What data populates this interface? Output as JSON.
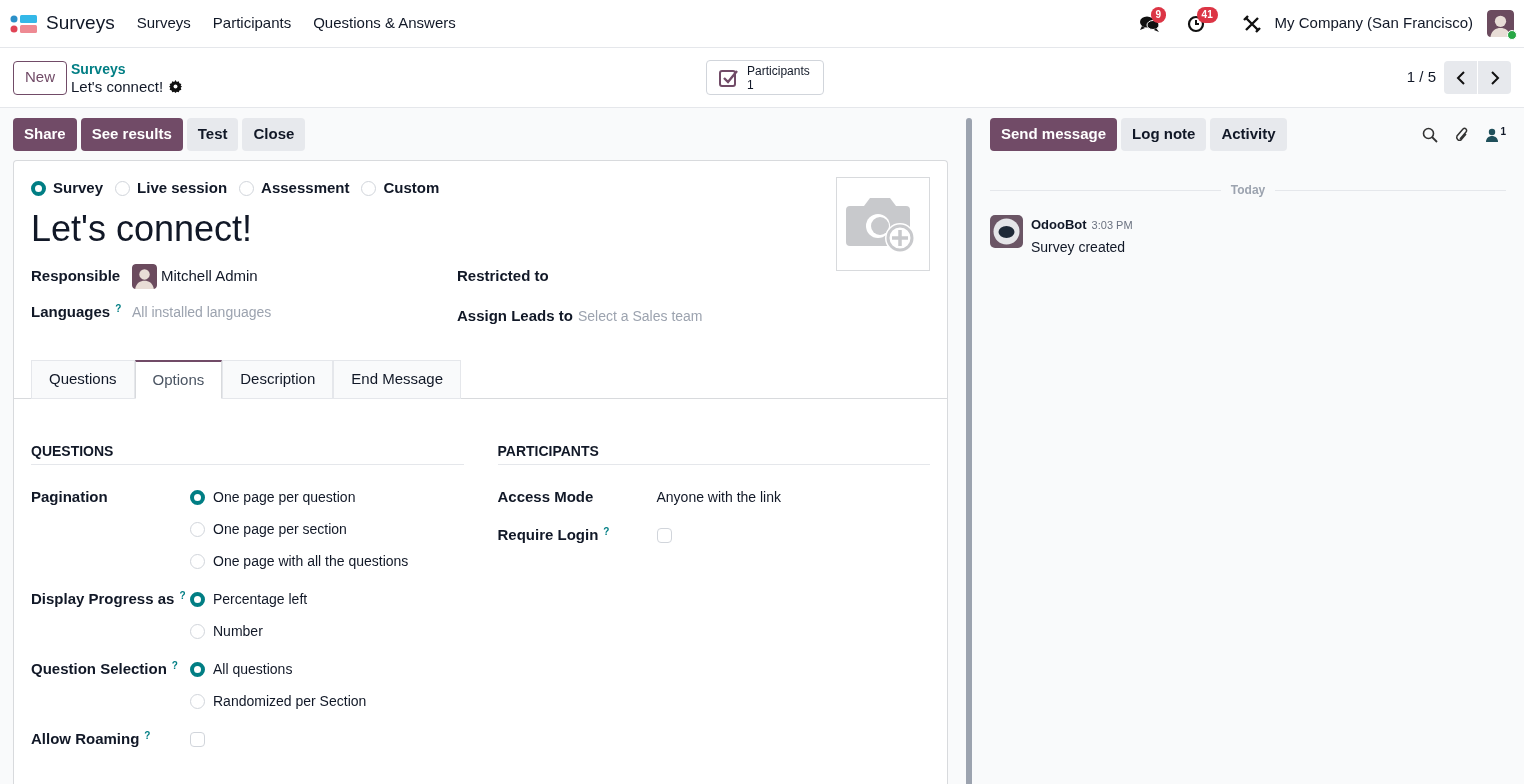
{
  "navbar": {
    "app_name": "Surveys",
    "menu": [
      "Surveys",
      "Participants",
      "Questions & Answers"
    ],
    "messages_badge": "9",
    "activities_badge": "41",
    "company": "My Company (San Francisco)"
  },
  "control_panel": {
    "new_button": "New",
    "breadcrumb": "Surveys",
    "record_title": "Let's connect!",
    "smart_button": {
      "label": "Participants",
      "value": "1"
    },
    "pager": "1 / 5"
  },
  "actions": [
    {
      "label": "Share",
      "kind": "primary"
    },
    {
      "label": "See results",
      "kind": "primary"
    },
    {
      "label": "Test",
      "kind": "secondary"
    },
    {
      "label": "Close",
      "kind": "secondary"
    }
  ],
  "form": {
    "survey_types": [
      {
        "label": "Survey",
        "selected": true
      },
      {
        "label": "Live session",
        "selected": false
      },
      {
        "label": "Assessment",
        "selected": false
      },
      {
        "label": "Custom",
        "selected": false
      }
    ],
    "title": "Let's connect!",
    "fields_left": [
      {
        "label": "Responsible",
        "kind": "user",
        "value": "Mitchell Admin"
      },
      {
        "label": "Languages",
        "help": "?",
        "kind": "input",
        "placeholder": "All installed languages"
      }
    ],
    "fields_right": [
      {
        "label": "Restricted to",
        "kind": "empty"
      },
      {
        "label": "Assign Leads to",
        "kind": "input",
        "placeholder": "Select a Sales team"
      }
    ],
    "tabs": [
      {
        "label": "Questions",
        "selected": false
      },
      {
        "label": "Options",
        "selected": true
      },
      {
        "label": "Description",
        "selected": false
      },
      {
        "label": "End Message",
        "selected": false
      }
    ],
    "sections": [
      {
        "title": "QUESTIONS",
        "rows": [
          {
            "label": "Pagination",
            "kind": "radio",
            "options": [
              {
                "label": "One page per question",
                "selected": true
              },
              {
                "label": "One page per section",
                "selected": false
              },
              {
                "label": "One page with all the questions",
                "selected": false
              }
            ]
          },
          {
            "label": "Display Progress as",
            "help": "?",
            "kind": "radio",
            "options": [
              {
                "label": "Percentage left",
                "selected": true
              },
              {
                "label": "Number",
                "selected": false
              }
            ]
          },
          {
            "label": "Question Selection",
            "help": "?",
            "kind": "radio",
            "options": [
              {
                "label": "All questions",
                "selected": true
              },
              {
                "label": "Randomized per Section",
                "selected": false
              }
            ]
          },
          {
            "label": "Allow Roaming",
            "help": "?",
            "kind": "checkbox",
            "checked": false
          }
        ]
      },
      {
        "title": "PARTICIPANTS",
        "rows": [
          {
            "label": "Access Mode",
            "kind": "text",
            "value": "Anyone with the link"
          },
          {
            "label": "Require Login",
            "help": "?",
            "kind": "checkbox",
            "checked": false
          }
        ]
      }
    ]
  },
  "chatter": {
    "buttons": [
      {
        "label": "Send message",
        "kind": "primary"
      },
      {
        "label": "Log note",
        "kind": "secondary"
      },
      {
        "label": "Activity",
        "kind": "secondary"
      }
    ],
    "followers_count": "1",
    "date_separator": "Today",
    "messages": [
      {
        "author": "OdooBot",
        "time": "3:03 PM",
        "body": "Survey created"
      }
    ]
  }
}
